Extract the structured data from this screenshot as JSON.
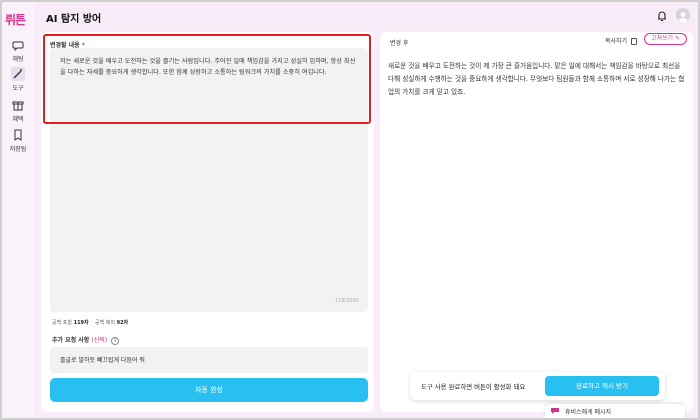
{
  "app": {
    "logo": "뤼튼",
    "title": "AI 탐지 방어"
  },
  "sidebar": {
    "items": [
      {
        "label": "채팅",
        "icon": "chat-bubble-icon"
      },
      {
        "label": "도구",
        "icon": "wand-icon",
        "active": true
      },
      {
        "label": "혜택",
        "icon": "gift-icon"
      },
      {
        "label": "저장됨",
        "icon": "bookmark-icon"
      }
    ]
  },
  "left": {
    "label": "변경할 내용",
    "required_mark": "*",
    "input_value": "저는 새로운 것을 배우고 도전하는 것을 즐기는 사람입니다. 주어진 일에 책임감을 가지고 성실히 임하며, 항상 최선을 다하는 자세를 중요하게 생각합니다. 또한 함께 성장하고 소통하는 팀워크의 가치를 소중히 여깁니다.",
    "counter": "119/2000",
    "stats_incl_label": "공백 포함",
    "stats_incl_value": "119자",
    "stats_excl_label": "공백 제외",
    "stats_excl_value": "92자",
    "extra_label": "추가 요청 사항",
    "extra_optional": "(선택)",
    "extra_value": "졸글로 말하듯 빼끄럽게 다듬어 줘",
    "auto_button": "자동 완성"
  },
  "right": {
    "label": "변경 후",
    "copy_button": "복사하기",
    "fix_button": "고쳐쓰기",
    "output_text": "새로운 것을 배우고 도전하는 것이 제 가장 큰 즐거움입니다. 맡은 일에 대해서는 책임감을 바탕으로 최선을 다해 성실하게 수행하는 것을 중요하게 생각합니다. 무엇보다 팀원들과 함께 소통하며 서로 성장해 나가는 협업의 가치를 크게 믿고 있죠."
  },
  "bottom": {
    "message": "도구 사용 완료하면 버튼이 활성화 돼요",
    "complete_button": "완료하고 캐시 받기",
    "chat_label": "휴비스에게 메시지"
  },
  "colors": {
    "brand": "#d6338a",
    "accent": "#27c0f0",
    "highlight": "#e02020"
  }
}
